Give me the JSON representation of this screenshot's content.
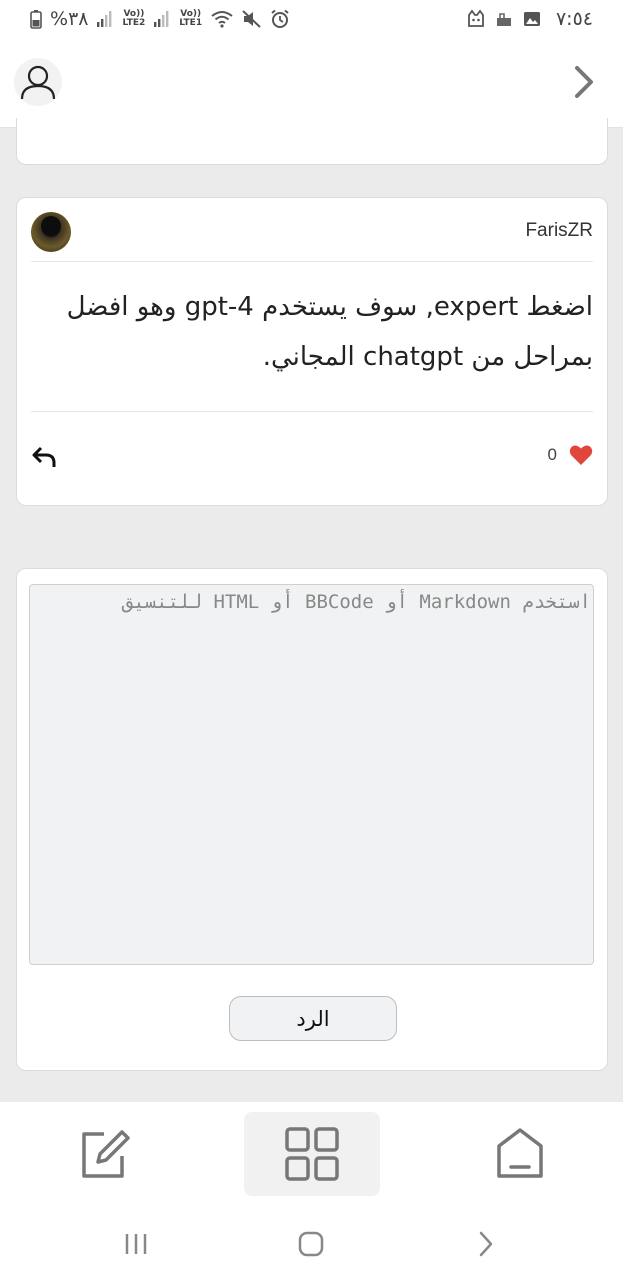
{
  "status_bar": {
    "battery": "%٣٨",
    "sim2": "LTE2",
    "sim1": "LTE1",
    "volte": "Vo))",
    "time": "٧:٥٤",
    "icons": [
      "battery-icon",
      "signal-icon",
      "wifi-icon",
      "mute-icon",
      "alarm-icon",
      "image-icon",
      "notification-icon",
      "app-icon"
    ]
  },
  "top_nav": {
    "avatar_icon": "user-icon",
    "back_icon": "chevron-right-icon"
  },
  "post": {
    "author": "FarisZR",
    "body": "اضغط expert, سوف يستخدم gpt-4 وهو افضل بمراحل من chatgpt المجاني.",
    "likes": "0",
    "like_color": "#e0463c"
  },
  "reply_form": {
    "placeholder": "استخدم Markdown أو BBCode أو HTML للتنسيق",
    "value": "",
    "submit_label": "الرد"
  },
  "bottom_nav": {
    "items": [
      "compose-icon",
      "grid-icon",
      "home-icon"
    ],
    "active": "grid-icon"
  },
  "system_nav": {
    "items": [
      "recents",
      "home",
      "back"
    ]
  }
}
